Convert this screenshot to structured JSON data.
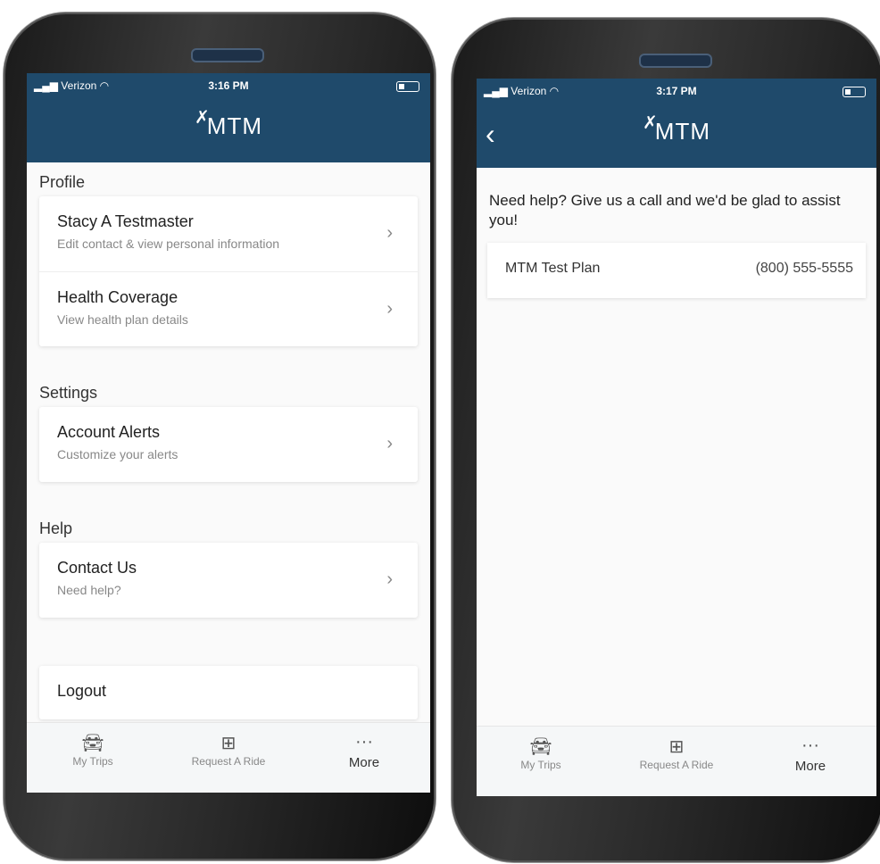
{
  "left": {
    "status": {
      "carrier": "Verizon",
      "time": "3:16 PM"
    },
    "logo": "MTM",
    "sections": [
      {
        "title": "Profile",
        "rows": [
          {
            "title": "Stacy A Testmaster",
            "subtitle": "Edit contact & view personal information"
          },
          {
            "title": "Health Coverage",
            "subtitle": "View health plan details"
          }
        ]
      },
      {
        "title": "Settings",
        "rows": [
          {
            "title": "Account Alerts",
            "subtitle": "Customize your alerts"
          }
        ]
      },
      {
        "title": "Help",
        "rows": [
          {
            "title": "Contact Us",
            "subtitle": "Need help?"
          }
        ]
      }
    ],
    "logout": "Logout",
    "tabs": {
      "trips": "My Trips",
      "request": "Request A Ride",
      "more": "More"
    }
  },
  "right": {
    "status": {
      "carrier": "Verizon",
      "time": "3:17 PM"
    },
    "logo": "MTM",
    "help_text": "Need help? Give us a call and we'd be glad to assist you!",
    "plan": {
      "name": "MTM Test Plan",
      "phone": "(800) 555-5555"
    },
    "tabs": {
      "trips": "My Trips",
      "request": "Request A Ride",
      "more": "More"
    }
  },
  "colors": {
    "header": "#1f4a6b",
    "background": "#fafafa"
  },
  "icons": {
    "back": "chevron-left-icon",
    "chevron": "chevron-right-icon",
    "car": "car-icon",
    "add": "plus-square-icon",
    "more": "more-dots-icon"
  }
}
